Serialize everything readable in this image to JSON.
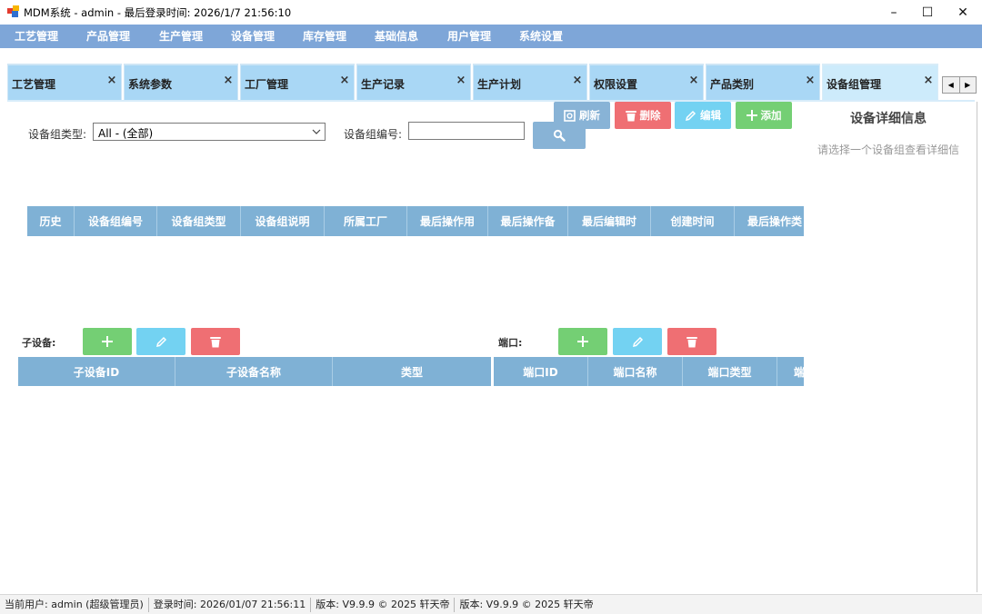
{
  "window": {
    "title": "MDM系统 - admin - 最后登录时间: 2026/1/7 21:56:10",
    "minimize": "–",
    "maximize": "☐",
    "close": "✕"
  },
  "menu": [
    "工艺管理",
    "产品管理",
    "生产管理",
    "设备管理",
    "库存管理",
    "基础信息",
    "用户管理",
    "系统设置"
  ],
  "tabs": [
    {
      "label": "工艺管理",
      "active": false
    },
    {
      "label": "系统参数",
      "active": false
    },
    {
      "label": "工厂管理",
      "active": false
    },
    {
      "label": "生产记录",
      "active": false
    },
    {
      "label": "生产计划",
      "active": false
    },
    {
      "label": "权限设置",
      "active": false
    },
    {
      "label": "产品类别",
      "active": false
    },
    {
      "label": "设备组管理",
      "active": true
    }
  ],
  "tab_close": "×",
  "tab_nav": {
    "prev": "◀",
    "next": "▶"
  },
  "toolbar": {
    "refresh": "刷新",
    "delete": "删除",
    "edit": "编辑",
    "add": "添加"
  },
  "filters": {
    "type_label": "设备组类型:",
    "type_value": "All - (全部)",
    "code_label": "设备组编号:",
    "code_value": ""
  },
  "main_grid": {
    "columns": [
      "历史",
      "设备组编号",
      "设备组类型",
      "设备组说明",
      "所属工厂",
      "最后操作用",
      "最后操作备",
      "最后编辑时",
      "创建时间",
      "最后操作类"
    ]
  },
  "sub_devices": {
    "label": "子设备:",
    "columns": [
      "子设备ID",
      "子设备名称",
      "类型"
    ]
  },
  "ports": {
    "label": "端口:",
    "columns": [
      "端口ID",
      "端口名称",
      "端口类型",
      "端"
    ]
  },
  "detail": {
    "title": "设备详细信息",
    "hint": "请选择一个设备组查看详细信"
  },
  "status": [
    "当前用户: admin (超级管理员)",
    "登录时间: 2026/01/07 21:56:11",
    "版本: V9.9.9 © 2025 轩天帝",
    "版本: V9.9.9 © 2025 轩天帝"
  ],
  "colors": {
    "menu_bg": "#7ea6d8",
    "tab_bg": "#a9d7f5",
    "grid_header": "#7fb1d5",
    "btn_blue": "#88b3d6",
    "btn_red": "#ef6f73",
    "btn_cyan": "#73d2f2",
    "btn_green": "#74cf74"
  }
}
